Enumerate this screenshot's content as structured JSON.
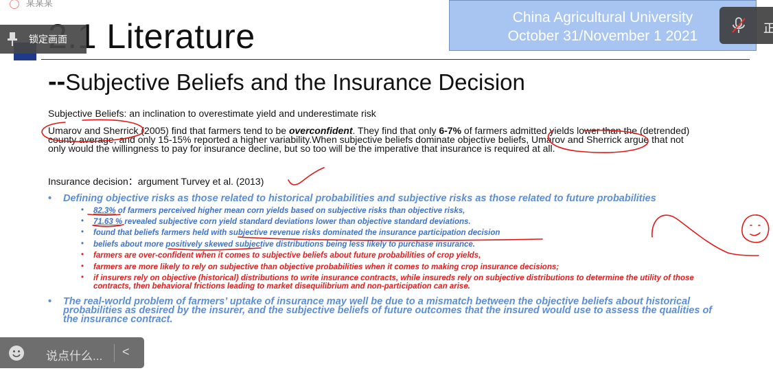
{
  "topbar": {
    "ghost_text": "某某某"
  },
  "lock_button": {
    "label": "锁定画面"
  },
  "slide": {
    "title": "2.1 Literature",
    "banner": {
      "line1": "China Agricultural University",
      "line2": "October 31/November 1 2021"
    },
    "subtitle_dash": "--",
    "subtitle": "Subjective Beliefs and the Insurance Decision",
    "def": "Subjective Beliefs: an inclination to overestimate yield and underestimate risk",
    "para": {
      "a": "Umarov and Sherrick (2005) find that farmers tend to be ",
      "b": "overconfident",
      "c": ". They find that only ",
      "d": "6-7%",
      "e": " of farmers admitted yields lower than the (detrended)",
      "line2": "county average, and only 15-15% reported a higher variability.When subjective beliefs dominate objective beliefs, Umarov and Sherrick argue that not",
      "line3": "only would the willingness to pay for insurance decline, but so too will be the imperative that insurance is required at all."
    },
    "insurance_decision": "Insurance decision：argument  Turvey et al. (2013)",
    "bullet_mark": "•",
    "sub_mark": "•",
    "bullet1": "Defining objective risks as those related to historical probabilities and subjective risks as those related to future probabilities",
    "subs": [
      {
        "num": "82.3%",
        "text": " of farmers perceived higher mean corn yields based on subjective risks than objective risks,"
      },
      {
        "num": "71.63 %",
        "text": " revealed subjective corn yield standard deviations lower than objective standard deviations."
      },
      {
        "text": "found that beliefs farmers held with subjective revenue risks dominated the insurance participation decision"
      },
      {
        "text": "beliefs about more positively skewed subjective distributions being less likely to purchase insurance."
      },
      {
        "text": "farmers are over-confident when it comes to subjective beliefs about future probabilities of crop yields,"
      },
      {
        "text": "farmers are more likely to rely on subjective than objective probabilities when it comes to making crop insurance decisions;"
      },
      {
        "line1": "if insurers rely on objective (historical) distributions to write insurance contracts, while insureds rely on subjective distributions to determine the utility of those",
        "line2": "contracts, then behavioral frictions leading to market disequilibrium and non-participation can arise."
      }
    ],
    "bullet2": {
      "line1": "The real-world problem of farmers’ uptake of insurance may well be due to a mismatch between the objective beliefs about historical",
      "line2": "probabilities as desired by the insurer, and the subjective beliefs of future outcomes that the insured would use to assess the qualities of",
      "line3": "the insurance contract."
    }
  },
  "mute_button": {
    "label": "正"
  },
  "chat": {
    "placeholder": "说点什么...",
    "collapse_glyph": "<"
  },
  "colors": {
    "bullet_blue": "#5b8ed6",
    "sub_blue": "#3e73c9",
    "sub_red": "#e21e1e",
    "banner": "#a7c5f0",
    "ink": "#e01818"
  }
}
